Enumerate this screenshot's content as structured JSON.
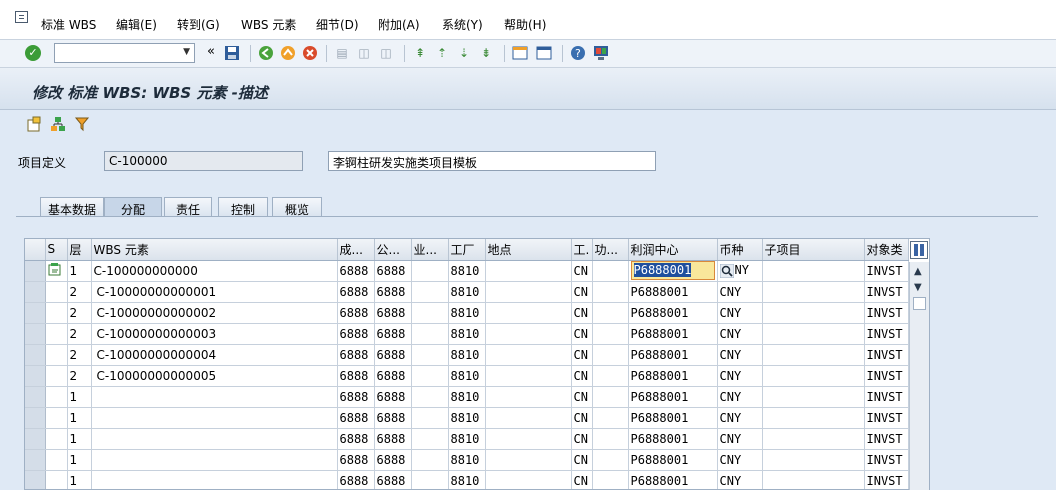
{
  "menu": [
    "标准 WBS",
    "编辑(E)",
    "转到(G)",
    "WBS 元素",
    "细节(D)",
    "附加(A)",
    "系统(Y)",
    "帮助(H)"
  ],
  "toolbar": {
    "command_value": "",
    "back_glyph": "«"
  },
  "title": "修改 标准 WBS: WBS 元素 -描述",
  "header": {
    "project_label": "项目定义",
    "project_value": "C-100000",
    "project_desc": "李锕柱研发实施类项目模板"
  },
  "tabs": [
    "基本数据",
    "分配",
    "责任",
    "控制",
    "概览"
  ],
  "active_tab": "分配",
  "table": {
    "columns": [
      "S",
      "层",
      "WBS 元素",
      "成...",
      "公...",
      "业...",
      "工厂",
      "地点",
      "工.",
      "功...",
      "利润中心",
      "币种",
      "子项目",
      "对象类"
    ],
    "rows": [
      [
        "",
        "1",
        "C-100000000000",
        "6888",
        "6888",
        "",
        "8810",
        "",
        "CN",
        "",
        "P6888001",
        "CNY",
        "",
        "INVST"
      ],
      [
        "",
        "2",
        "C-10000000000001",
        "6888",
        "6888",
        "",
        "8810",
        "",
        "CN",
        "",
        "P6888001",
        "CNY",
        "",
        "INVST"
      ],
      [
        "",
        "2",
        "C-10000000000002",
        "6888",
        "6888",
        "",
        "8810",
        "",
        "CN",
        "",
        "P6888001",
        "CNY",
        "",
        "INVST"
      ],
      [
        "",
        "2",
        "C-10000000000003",
        "6888",
        "6888",
        "",
        "8810",
        "",
        "CN",
        "",
        "P6888001",
        "CNY",
        "",
        "INVST"
      ],
      [
        "",
        "2",
        "C-10000000000004",
        "6888",
        "6888",
        "",
        "8810",
        "",
        "CN",
        "",
        "P6888001",
        "CNY",
        "",
        "INVST"
      ],
      [
        "",
        "2",
        "C-10000000000005",
        "6888",
        "6888",
        "",
        "8810",
        "",
        "CN",
        "",
        "P6888001",
        "CNY",
        "",
        "INVST"
      ],
      [
        "",
        "1",
        "",
        "6888",
        "6888",
        "",
        "8810",
        "",
        "CN",
        "",
        "P6888001",
        "CNY",
        "",
        "INVST"
      ],
      [
        "",
        "1",
        "",
        "6888",
        "6888",
        "",
        "8810",
        "",
        "CN",
        "",
        "P6888001",
        "CNY",
        "",
        "INVST"
      ],
      [
        "",
        "1",
        "",
        "6888",
        "6888",
        "",
        "8810",
        "",
        "CN",
        "",
        "P6888001",
        "CNY",
        "",
        "INVST"
      ],
      [
        "",
        "1",
        "",
        "6888",
        "6888",
        "",
        "8810",
        "",
        "CN",
        "",
        "P6888001",
        "CNY",
        "",
        "INVST"
      ],
      [
        "",
        "1",
        "",
        "6888",
        "6888",
        "",
        "8810",
        "",
        "CN",
        "",
        "P6888001",
        "CNY",
        "",
        "INVST"
      ]
    ]
  },
  "colors": {
    "accent": "#1f4f9e",
    "focus_field": "#f9e79b",
    "ok": "#3b9c37"
  },
  "icons": [
    "system-menu-icon",
    "ok-check-icon",
    "save-icon",
    "back-icon",
    "exit-icon",
    "cancel-icon",
    "print-icon",
    "find-icon",
    "find-next-icon",
    "first-page-icon",
    "previous-page-icon",
    "next-page-icon",
    "last-page-icon",
    "create-session-icon",
    "shortcut-icon",
    "help-icon",
    "customize-layout-icon"
  ]
}
